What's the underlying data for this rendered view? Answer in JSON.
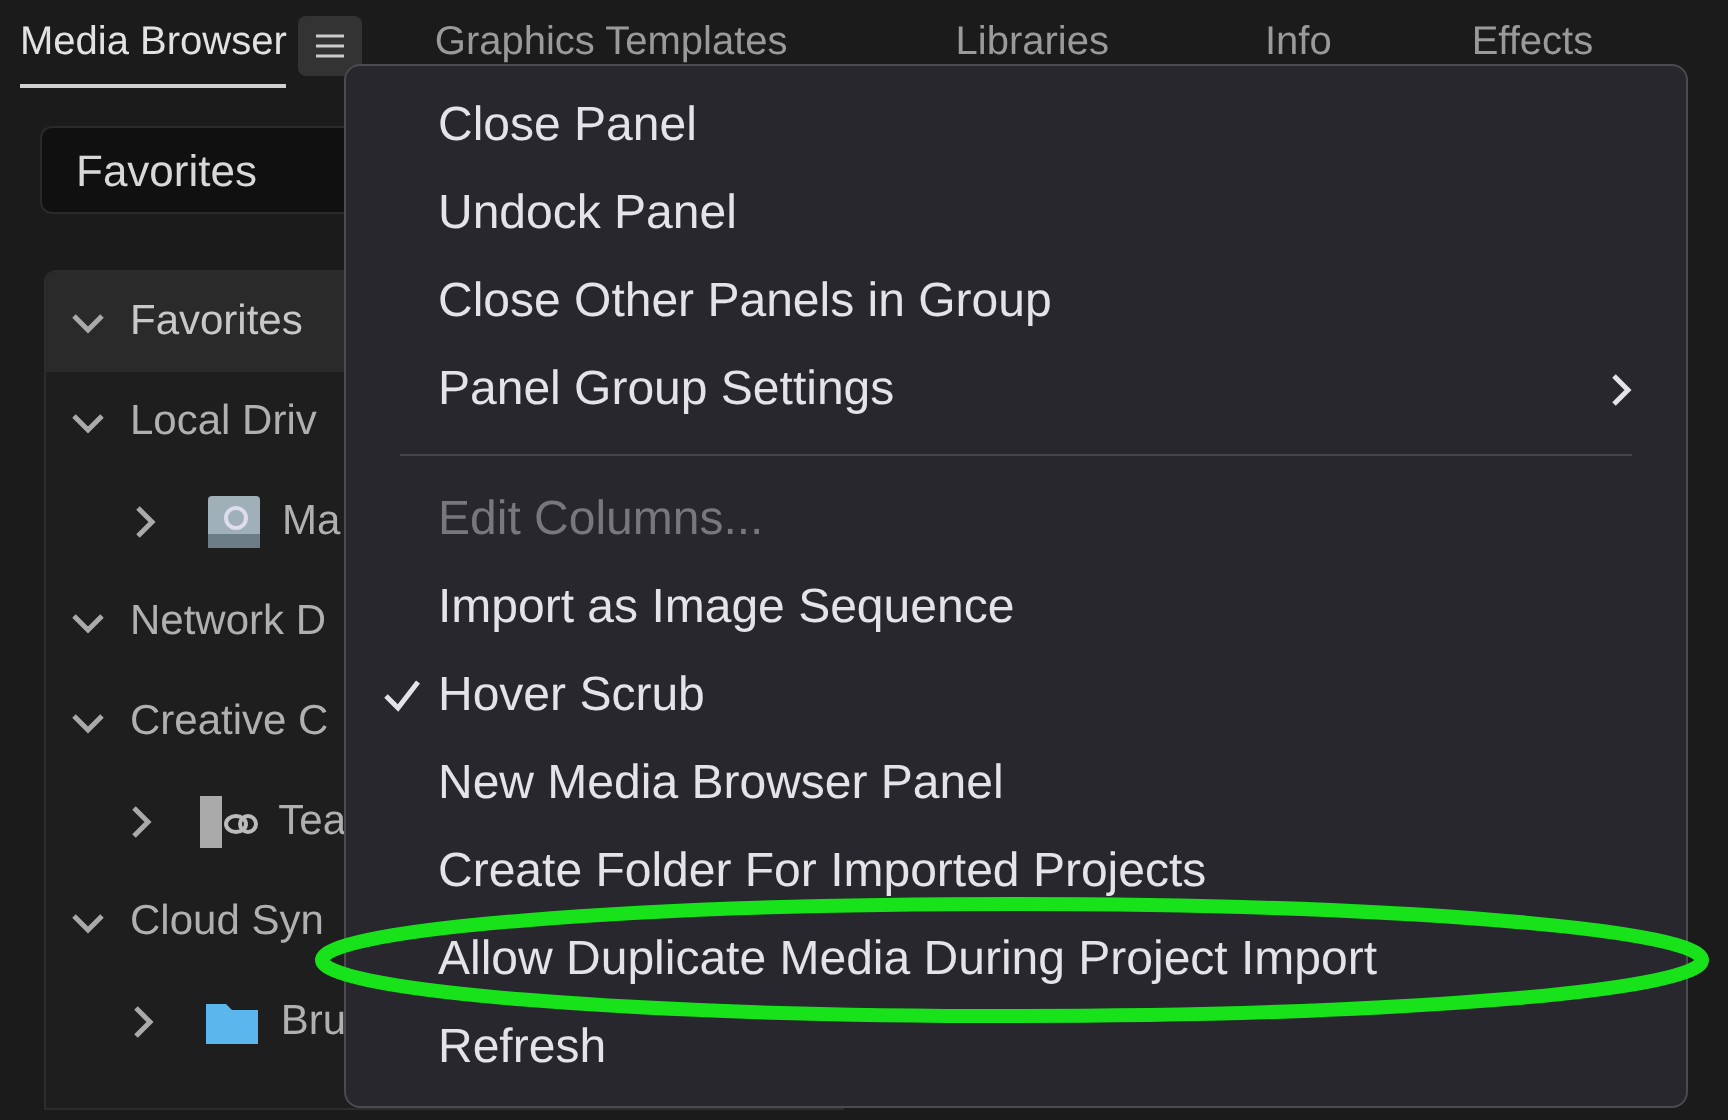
{
  "tabs": [
    {
      "label": "Media Browser",
      "selected": true
    },
    {
      "label": "Graphics Templates",
      "selected": false
    },
    {
      "label": "Libraries",
      "selected": false
    },
    {
      "label": "Info",
      "selected": false
    },
    {
      "label": "Effects",
      "selected": false
    }
  ],
  "location_dropdown": {
    "value": "Favorites"
  },
  "tree": [
    {
      "label": "Favorites",
      "expanded": true,
      "selected": true
    },
    {
      "label": "Local Driv",
      "expanded": true,
      "selected": false,
      "children": [
        {
          "label": "Ma",
          "expanded": false,
          "kind": "drive"
        }
      ]
    },
    {
      "label": "Network D",
      "expanded": true,
      "selected": false
    },
    {
      "label": "Creative C",
      "expanded": true,
      "selected": false,
      "children": [
        {
          "label": "Tea",
          "expanded": false,
          "kind": "team"
        }
      ]
    },
    {
      "label": "Cloud Syn",
      "expanded": true,
      "selected": false,
      "children": [
        {
          "label": "Bru",
          "expanded": false,
          "kind": "folder"
        }
      ]
    }
  ],
  "menu": {
    "items": [
      {
        "kind": "item",
        "label": "Close Panel",
        "checked": false,
        "disabled": false
      },
      {
        "kind": "item",
        "label": "Undock Panel",
        "checked": false,
        "disabled": false
      },
      {
        "kind": "item",
        "label": "Close Other Panels in Group",
        "checked": false,
        "disabled": false
      },
      {
        "kind": "submenu",
        "label": "Panel Group Settings",
        "checked": false,
        "disabled": false
      },
      {
        "kind": "separator"
      },
      {
        "kind": "item",
        "label": "Edit Columns...",
        "checked": false,
        "disabled": true
      },
      {
        "kind": "item",
        "label": "Import as Image Sequence",
        "checked": false,
        "disabled": false
      },
      {
        "kind": "item",
        "label": "Hover Scrub",
        "checked": true,
        "disabled": false
      },
      {
        "kind": "item",
        "label": "New Media Browser Panel",
        "checked": false,
        "disabled": false
      },
      {
        "kind": "item",
        "label": "Create Folder For Imported Projects",
        "checked": false,
        "disabled": false
      },
      {
        "kind": "item",
        "label": "Allow Duplicate Media During Project Import",
        "checked": false,
        "disabled": false,
        "highlighted": true
      },
      {
        "kind": "item",
        "label": "Refresh",
        "checked": false,
        "disabled": false
      }
    ]
  }
}
